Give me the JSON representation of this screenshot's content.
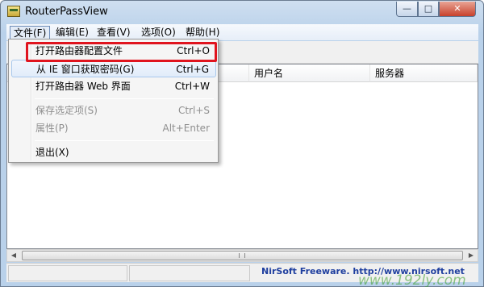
{
  "window": {
    "title": "RouterPassView"
  },
  "titlebar_buttons": {
    "minimize": "—",
    "maximize": "□",
    "close": "✕"
  },
  "menubar": [
    {
      "label": "文件(F)"
    },
    {
      "label": "编辑(E)"
    },
    {
      "label": "查看(V)"
    },
    {
      "label": "选项(O)"
    },
    {
      "label": "帮助(H)"
    }
  ],
  "list": {
    "columns": [
      "用户名",
      "服务器"
    ]
  },
  "file_menu": [
    {
      "label": "打开路由器配置文件",
      "shortcut": "Ctrl+O",
      "enabled": true
    },
    {
      "label": "从 IE 窗口获取密码(G)",
      "shortcut": "Ctrl+G",
      "enabled": true
    },
    {
      "label": "打开路由器 Web 界面",
      "shortcut": "Ctrl+W",
      "enabled": true
    },
    {
      "label": "保存选定项(S)",
      "shortcut": "Ctrl+S",
      "enabled": false
    },
    {
      "label": "属性(P)",
      "shortcut": "Alt+Enter",
      "enabled": false
    },
    {
      "label": "退出(X)",
      "shortcut": "",
      "enabled": true
    }
  ],
  "statusbar": {
    "link": "NirSoft Freeware.  http://www.nirsoft.net"
  },
  "watermark": "www.192ly.com",
  "colors": {
    "highlight_border": "#e0141e",
    "link": "#1f3f9f"
  }
}
